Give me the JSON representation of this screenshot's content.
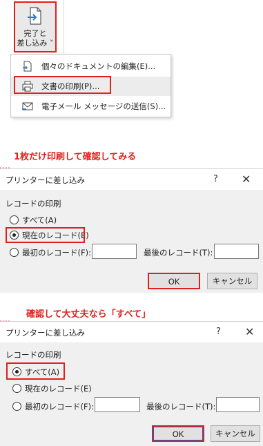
{
  "ribbon": {
    "button_line1": "完了と",
    "button_line2": "差し込み ˅",
    "icon": "finish-merge-icon"
  },
  "menu": {
    "items": [
      {
        "label": "個々のドキュメントの編集(E)...",
        "icon": "document-edit-icon"
      },
      {
        "label": "文書の印刷(P)...",
        "icon": "printer-icon"
      },
      {
        "label": "電子メール メッセージの送信(S)...",
        "icon": "envelope-icon"
      }
    ]
  },
  "caption1": "1枚だけ印刷して確認してみる",
  "caption2": "確認して大丈夫なら「すべて」",
  "dialog": {
    "title": "プリンターに差し込み",
    "help": "?",
    "close": "✕",
    "group_label": "レコードの印刷",
    "options": {
      "all": "すべて(A)",
      "current": "現在のレコード(E)",
      "first": "最初のレコード(F):"
    },
    "last_label": "最後のレコード(T):",
    "first_value": "",
    "last_value": "",
    "ok": "OK",
    "cancel": "キャンセル"
  },
  "dialog1_selected": "current",
  "dialog2_selected": "all",
  "colors": {
    "highlight": "#e0201e",
    "dialog_bg": "#f0f0f0"
  }
}
